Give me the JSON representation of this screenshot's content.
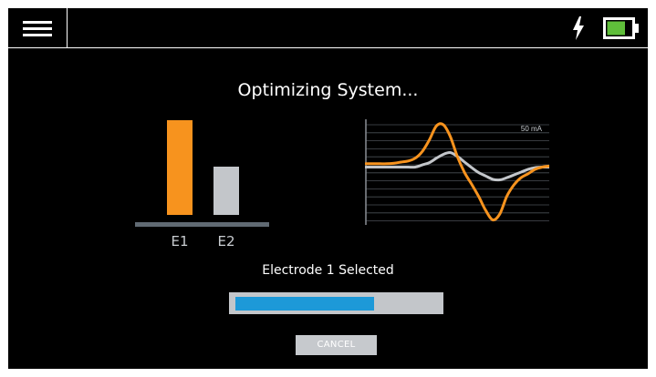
{
  "header": {
    "menu_icon": "hamburger-menu-icon",
    "charging_icon": "lightning-bolt-icon",
    "battery_icon": "battery-icon",
    "battery_level": 0.75,
    "battery_color": "#5fbe3a"
  },
  "main": {
    "title": "Optimizing System...",
    "electrodes": [
      {
        "label": "E1",
        "level": 1.0,
        "color": "#f7931e"
      },
      {
        "label": "E2",
        "level": 0.51,
        "color": "#c3c6ca"
      }
    ],
    "status": "Electrode 1 Selected",
    "progress": 0.69,
    "progress_color": "#1d99d8",
    "cancel_label": "CANCEL"
  },
  "chart_data": {
    "type": "line",
    "annotation": "50 mA",
    "series": [
      {
        "color": "#f7931e",
        "values": [
          50,
          50,
          50,
          50,
          51,
          53,
          55,
          60,
          72,
          93,
          118,
          120,
          98,
          62,
          34,
          13,
          -9,
          -34,
          -51,
          -40,
          -8,
          12,
          25,
          32,
          40,
          44,
          46
        ]
      },
      {
        "color": "#c3c6ca",
        "values": [
          44,
          44,
          44,
          44,
          44,
          44,
          44,
          44,
          48,
          52,
          60,
          67,
          70,
          63,
          53,
          43,
          34,
          28,
          22,
          21,
          25,
          30,
          35,
          40,
          43,
          44,
          44
        ]
      }
    ]
  }
}
